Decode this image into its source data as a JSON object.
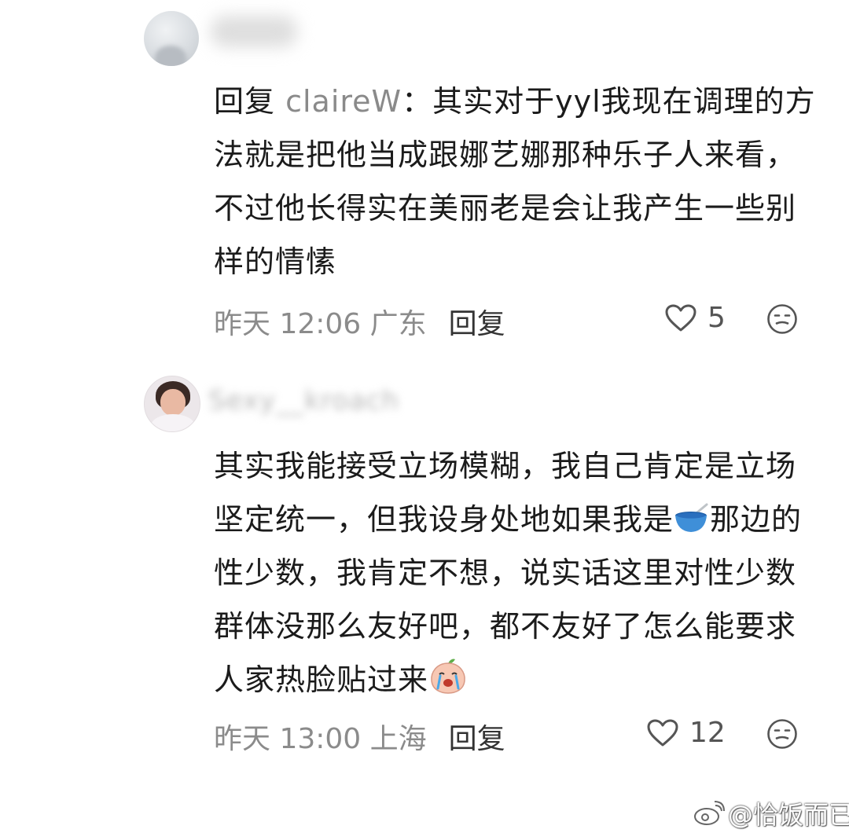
{
  "comments": [
    {
      "mention_prefix": "回复 ",
      "mention_name": "claireW",
      "text": "：其实对于yyl我现在调理的方法就是把他当成跟娜艺娜那种乐子人来看，不过他长得实在美丽老是会让我产生一些别样的情愫",
      "meta": "昨天 12:06 广东",
      "reply_label": "回复",
      "likes": "5",
      "like_icon": "heart-outline-icon",
      "reaction_icon": "meh-face-icon"
    },
    {
      "username": "Sexy__kroach",
      "text_part1": "其实我能接受立场模糊，我自己肯定是立场坚定统一，但我设身处地如果我是",
      "emoji1": "bowl-emoji",
      "text_part2": "那边的性少数，我肯定不想，说实话这里对性少数群体没那么友好吧，都不友好了怎么能要求人家热脸贴过来",
      "emoji2": "crying-peach-emoji",
      "meta": "昨天 13:00 上海",
      "reply_label": "回复",
      "likes": "12",
      "like_icon": "heart-outline-icon",
      "reaction_icon": "meh-face-icon"
    }
  ],
  "watermark": "@恰饭而已",
  "colors": {
    "text": "#1b1b1b",
    "meta": "#8b8b8b",
    "mention": "#8a8a8a",
    "bowl": "#3f8fd8"
  }
}
